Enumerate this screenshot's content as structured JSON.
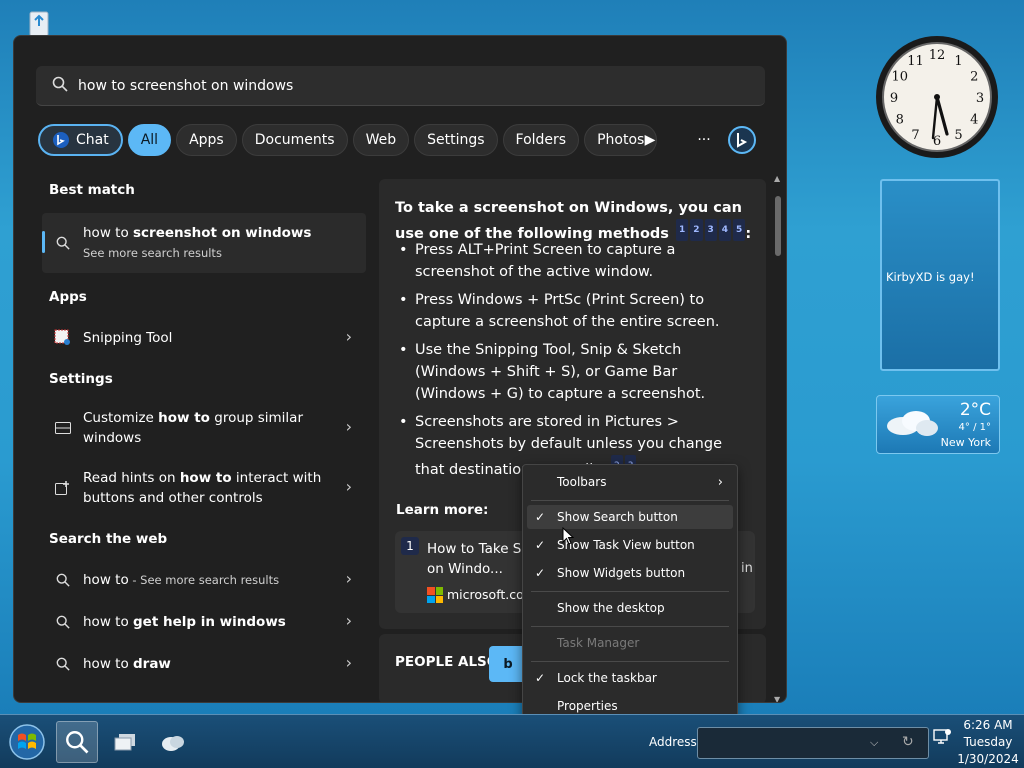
{
  "search": {
    "query": "how to screenshot on windows"
  },
  "filters": [
    {
      "label": "Chat"
    },
    {
      "label": "All"
    },
    {
      "label": "Apps"
    },
    {
      "label": "Documents"
    },
    {
      "label": "Web"
    },
    {
      "label": "Settings"
    },
    {
      "label": "Folders"
    },
    {
      "label": "Photos"
    }
  ],
  "left": {
    "best_match_heading": "Best match",
    "best_match": {
      "prefix": "how to ",
      "bold": "screenshot on windows",
      "sub": "See more search results"
    },
    "apps_heading": "Apps",
    "app": {
      "label": "Snipping Tool"
    },
    "settings_heading": "Settings",
    "setting1": {
      "pre": "Customize ",
      "bold": "how to",
      "post": " group similar windows"
    },
    "setting2": {
      "pre": "Read hints on ",
      "bold": "how to",
      "post": " interact with buttons and other controls"
    },
    "web_heading": "Search the web",
    "web1": {
      "pre": "how to",
      "sub": " - See more search results"
    },
    "web2": {
      "pre": "how to ",
      "bold": "get help in windows"
    },
    "web3": {
      "pre": "how to ",
      "bold": "draw"
    }
  },
  "preview": {
    "title": "To take a screenshot on Windows, you can use one of the following methods",
    "title_cites": [
      "1",
      "2",
      "3",
      "4",
      "5"
    ],
    "bullets": [
      "Press ALT+Print Screen to capture a screenshot of the active window.",
      "Press Windows + PrtSc (Print Screen) to capture a screenshot of the entire screen.",
      "Use the Snipping Tool, Snip & Sketch (Windows + Shift + S), or Game Bar (Windows + G) to capture a screenshot.",
      "Screenshots are stored in Pictures > Screenshots by default unless you change that destination manually."
    ],
    "bullet_cites": [
      "2",
      "3"
    ],
    "learn_more": "Learn more:",
    "card": {
      "num": "1",
      "title": "How to Take Scr on Windo...",
      "source": "microsoft.com",
      "extra": "in"
    },
    "people_also": "PEOPLE ALSO"
  },
  "context_menu": {
    "toolbars": "Toolbars",
    "show_search": "Show Search button",
    "show_taskview": "Show Task View button",
    "show_widgets": "Show Widgets button",
    "show_desktop": "Show the desktop",
    "task_manager": "Task Manager",
    "lock_taskbar": "Lock the taskbar",
    "properties": "Properties"
  },
  "gadgets": {
    "note_text": "KirbyXD is gay!",
    "weather": {
      "temp": "2°C",
      "range": "4° / 1°",
      "city": "New York"
    },
    "clock_numbers": [
      "12",
      "1",
      "2",
      "3",
      "4",
      "5",
      "6",
      "7",
      "8",
      "9",
      "10",
      "11"
    ]
  },
  "taskbar": {
    "address_label": "Address",
    "time": "6:26 AM",
    "day": "Tuesday",
    "date": "1/30/2024"
  },
  "colors": {
    "accent": "#5cb8f6",
    "panel_bg": "#202020",
    "chip_bg": "#2d2d2d"
  }
}
